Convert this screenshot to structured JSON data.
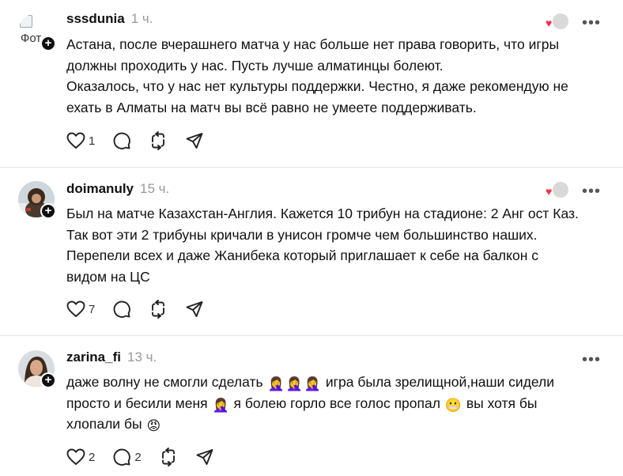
{
  "posts": [
    {
      "username": "sssdunia",
      "time": "1 ч.",
      "avatar_alt": "Фот",
      "lines": [
        "Астана, после вчерашнего матча у нас больше нет права говорить, что игры",
        "должны проходить у нас. Пусть лучше алматинцы болеют.",
        "Оказалось, что у нас нет культуры поддержки. Честно, я даже рекомендую не",
        "ехать в Алматы на матч вы всё равно не умеете поддерживать."
      ],
      "likes": "1",
      "comments": "",
      "reposts": ""
    },
    {
      "username": "doimanuly",
      "time": "15 ч.",
      "lines": [
        "Был на матче Казахстан-Англия. Кажется 10 трибун на стадионе: 2 Анг ост Каз.",
        "Так вот эти 2 трибуны кричали в унисон громче чем большинство наших.",
        "Перепели всех и даже Жанибека который приглашает к себе на балкон с",
        "видом на ЦС"
      ],
      "likes": "7",
      "comments": "",
      "reposts": ""
    },
    {
      "username": "zarina_fi",
      "time": "13 ч.",
      "line1_a": "даже волну не смогли сделать",
      "line1_b": "игра была зрелищной,наши сидели",
      "line2_a": "просто и бесили меня",
      "line2_b": "я болею горло все голос пропал",
      "line2_c": "вы хотя бы",
      "line3_a": "хлопали бы",
      "emoji_facepalm": "🤦‍♀️",
      "emoji_grimace": "😬",
      "emoji_angry": "😡",
      "likes": "2",
      "comments": "2",
      "reposts": ""
    }
  ],
  "icons": [
    "heart-icon",
    "comment-icon",
    "repost-icon",
    "share-icon",
    "more-icon",
    "follow-plus-icon"
  ],
  "colors": {
    "accent_heart": "#ff3040",
    "muted": "#999999",
    "text": "#101010"
  }
}
